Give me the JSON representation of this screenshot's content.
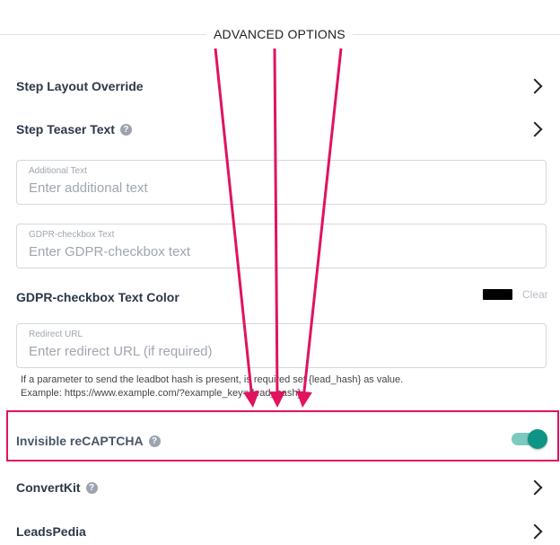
{
  "section": {
    "title": "ADVANCED OPTIONS"
  },
  "rows": {
    "step_layout_override": "Step Layout Override",
    "step_teaser_text": "Step Teaser Text",
    "gdpr_color": "GDPR-checkbox Text Color",
    "invisible_recaptcha": "Invisible reCAPTCHA",
    "convertkit": "ConvertKit",
    "leadspedia": "LeadsPedia"
  },
  "fields": {
    "additional_text": {
      "label": "Additional Text",
      "placeholder": "Enter additional text",
      "value": ""
    },
    "gdpr_text": {
      "label": "GDPR-checkbox Text",
      "placeholder": "Enter GDPR-checkbox text",
      "value": ""
    },
    "redirect_url": {
      "label": "Redirect URL",
      "placeholder": "Enter redirect URL (if required)",
      "value": ""
    }
  },
  "color_picker": {
    "color": "#000000",
    "clear_label": "Clear"
  },
  "hint": {
    "line1": "If a parameter to send the leadbot hash is present, is required set {lead_hash} as value.",
    "line2": "Example: https://www.example.com/?example_key={lead_hash}"
  },
  "recaptcha_toggle": {
    "enabled": true
  },
  "icons": {
    "help": "help-circle-icon",
    "chevron": "chevron-right-icon"
  },
  "colors": {
    "accent": "#0e9484",
    "annotation": "#e0135f"
  }
}
